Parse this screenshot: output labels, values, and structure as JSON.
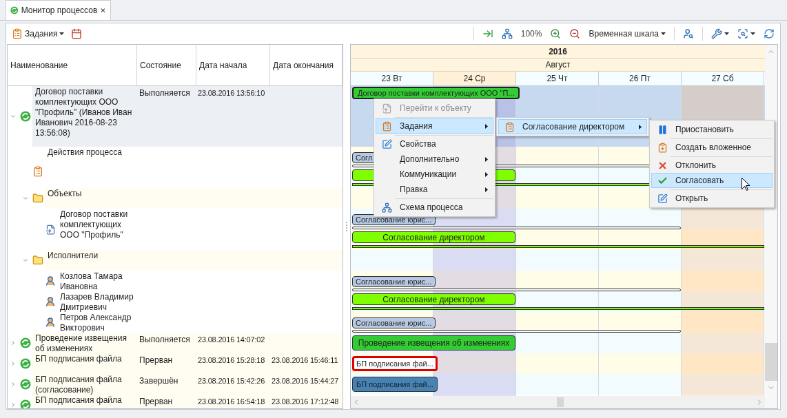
{
  "tab": {
    "title": "Монитор процессов"
  },
  "toolbar": {
    "tasks_button": "Задания",
    "zoom": "100%",
    "timescale_button": "Временная шкала"
  },
  "tree": {
    "columns": [
      "Наименование",
      "Состояние",
      "Дата начала",
      "Дата окончания"
    ],
    "rows": [
      {
        "kind": "process",
        "name": "Договор поставки комплектующих ООО \"Профиль\" (Иванов Иван Иванович 2016-08-23 13:56:08)",
        "state": "Выполняется",
        "start": "23.08.2016 13:56:10",
        "expanded": true,
        "selected": true,
        "children": [
          {
            "kind": "actions",
            "name": "Действия процесса",
            "selected": false
          },
          {
            "kind": "folder",
            "name": "Объекты",
            "expanded": true,
            "selected": false,
            "children": [
              {
                "kind": "document",
                "name": "Договор поставки комплектующих ООО \"Профиль\"",
                "selected": false
              }
            ]
          },
          {
            "kind": "folder",
            "name": "Исполнители",
            "expanded": true,
            "selected": false,
            "children": [
              {
                "kind": "person",
                "name": "Козлова Тамара Ивановна",
                "selected": false
              },
              {
                "kind": "person",
                "name": "Лазарев Владимир Дмитриевич",
                "selected": false
              },
              {
                "kind": "person",
                "name": "Петров Александр Викторович",
                "selected": false
              }
            ]
          }
        ]
      },
      {
        "kind": "process",
        "name": "Проведение извещения об изменениях",
        "state": "Выполняется",
        "start": "23.08.2016 14:07:02",
        "expanded": false,
        "selected": false
      },
      {
        "kind": "process",
        "name": "БП подписания файла",
        "state": "Прерван",
        "start": "23.08.2016 15:28:18",
        "end": "23.08.2016 15:46:11",
        "expanded": false,
        "selected": false
      },
      {
        "kind": "process",
        "name": "БП подписания файла (согласование)",
        "state": "Завершён",
        "start": "23.08.2016 15:42:26",
        "end": "23.08.2016 15:44:27",
        "expanded": false,
        "selected": false
      },
      {
        "kind": "process",
        "name": "БП подписания файла",
        "state": "Прерван",
        "start": "23.08.2016 16:54:18",
        "end": "23.08.2016 17:12:48",
        "expanded": false,
        "selected": false
      }
    ]
  },
  "timeline": {
    "year": "2016",
    "month": "Август",
    "days": [
      {
        "label": "23 Вт",
        "kind": "weekday"
      },
      {
        "label": "24 Ср",
        "kind": "current"
      },
      {
        "label": "25 Чт",
        "kind": "weekday"
      },
      {
        "label": "26 Пт",
        "kind": "weekday"
      },
      {
        "label": "27 Сб",
        "kind": "weekend"
      }
    ],
    "rows": [
      {
        "kind": "summary",
        "text": "Договор поставки комплектующих ООО \"П...",
        "color": "#33cc33"
      },
      {
        "kind": "task",
        "text": "Согл",
        "color": "#b7c9e2"
      },
      {
        "kind": "director",
        "color": "#80ff00"
      },
      {
        "kind": "empty"
      },
      {
        "kind": "task",
        "text": "Согласование юрис...",
        "color": "#b7c9e2"
      },
      {
        "kind": "director",
        "text": "Согласование директором",
        "color": "#80ff00"
      },
      {
        "kind": "empty"
      },
      {
        "kind": "task",
        "text": "Согласование юрис...",
        "color": "#b7c9e2"
      },
      {
        "kind": "director",
        "text": "Согласование директором",
        "color": "#80ff00"
      },
      {
        "kind": "task",
        "text": "Согласование юрис...",
        "color": "#b7c9e2"
      },
      {
        "kind": "process",
        "text": "Проведение извещения об изменениях",
        "color": "#33cc33"
      },
      {
        "kind": "failed",
        "text": "БП подписания фай...",
        "color": "#ffffff"
      },
      {
        "kind": "done",
        "text": "БП подписания фай...",
        "color": "#4682b4"
      }
    ]
  },
  "context_menu": {
    "items": [
      {
        "kind": "item",
        "label": "Перейти к объекту",
        "disabled": true,
        "selected": false,
        "has_submenu": false
      },
      {
        "kind": "separator"
      },
      {
        "kind": "item",
        "label": "Задания",
        "disabled": false,
        "selected": true,
        "has_submenu": true
      },
      {
        "kind": "separator"
      },
      {
        "kind": "item",
        "label": "Свойства",
        "disabled": false,
        "selected": false,
        "has_submenu": false
      },
      {
        "kind": "item",
        "label": "Дополнительно",
        "disabled": false,
        "selected": false,
        "has_submenu": true
      },
      {
        "kind": "item",
        "label": "Коммуникации",
        "disabled": false,
        "selected": false,
        "has_submenu": true
      },
      {
        "kind": "item",
        "label": "Правка",
        "disabled": false,
        "selected": false,
        "has_submenu": true
      },
      {
        "kind": "separator"
      },
      {
        "kind": "item",
        "label": "Схема процесса",
        "disabled": false,
        "selected": false,
        "has_submenu": false
      }
    ]
  },
  "tasks_submenu": {
    "items": [
      {
        "kind": "item",
        "label": "Согласование директором",
        "disabled": false,
        "selected": true,
        "has_submenu": true
      }
    ]
  },
  "task_actions_submenu": {
    "items": [
      {
        "kind": "item",
        "label": "Приостановить",
        "disabled": false,
        "selected": false,
        "has_submenu": false
      },
      {
        "kind": "separator"
      },
      {
        "kind": "item",
        "label": "Создать вложенное",
        "disabled": false,
        "selected": false,
        "has_submenu": false
      },
      {
        "kind": "separator"
      },
      {
        "kind": "item",
        "label": "Отклонить",
        "disabled": false,
        "selected": false,
        "has_submenu": false
      },
      {
        "kind": "item",
        "label": "Согласовать",
        "disabled": false,
        "selected": true,
        "has_submenu": false
      },
      {
        "kind": "separator"
      },
      {
        "kind": "item",
        "label": "Открыть",
        "disabled": false,
        "selected": false,
        "has_submenu": false
      }
    ]
  }
}
